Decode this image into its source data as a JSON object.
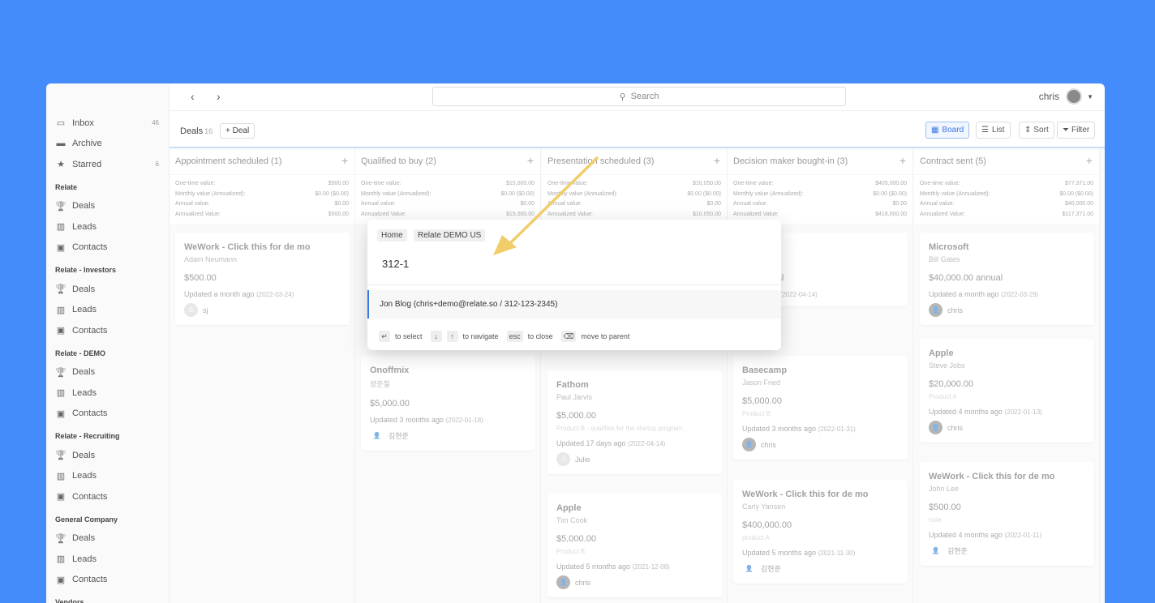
{
  "sidebar": {
    "top": [
      {
        "label": "Inbox",
        "count": "46",
        "icon": "inbox-icon"
      },
      {
        "label": "Archive",
        "count": "",
        "icon": "archive-icon"
      },
      {
        "label": "Starred",
        "count": "6",
        "icon": "star-icon"
      }
    ],
    "groups": [
      {
        "title": "Relate",
        "items": [
          "Deals",
          "Leads",
          "Contacts"
        ]
      },
      {
        "title": "Relate - Investors",
        "items": [
          "Deals",
          "Leads",
          "Contacts"
        ]
      },
      {
        "title": "Relate - DEMO",
        "items": [
          "Deals",
          "Leads",
          "Contacts"
        ]
      },
      {
        "title": "Relate - Recruiting",
        "items": [
          "Deals",
          "Leads",
          "Contacts"
        ]
      },
      {
        "title": "General Company",
        "items": [
          "Deals",
          "Leads",
          "Contacts"
        ]
      },
      {
        "title": "Vendors",
        "items": []
      }
    ]
  },
  "header": {
    "search_placeholder": "Search",
    "user": "chris"
  },
  "toolbar": {
    "title": "Deals",
    "count": "16",
    "add_deal": "+ Deal",
    "board": "Board",
    "list": "List",
    "sort": "Sort",
    "filter": "Filter"
  },
  "stat_labels": [
    "One-time value:",
    "Monthly value (Annualized):",
    "Annual value:",
    "Annualized Value:"
  ],
  "columns": [
    {
      "title": "Appointment scheduled (1)",
      "stats": [
        "$500.00",
        "$0.00 ($0.00)",
        "$0.00",
        "$500.00"
      ],
      "cards": [
        {
          "title": "WeWork - Click this for de mo",
          "person": "Adam Neumann",
          "value": "$500.00",
          "product": "",
          "updated": "Updated a month ago",
          "date": "(2022-03-24)",
          "owner": "sj",
          "owner_initial": "S"
        }
      ]
    },
    {
      "title": "Qualified to buy (2)",
      "stats": [
        "$15,000.00",
        "$0.00 ($0.00)",
        "$0.00",
        "$15,000.00"
      ],
      "cards": [
        {
          "title": "Onoffmix",
          "person": "양준철",
          "value": "$5,000.00",
          "product": "",
          "updated": "Updated 3 months ago",
          "date": "(2022-01-18)",
          "owner": "김현준",
          "owner_initial": ""
        }
      ]
    },
    {
      "title": "Presentation scheduled (3)",
      "stats": [
        "$10,050.00",
        "$0.00 ($0.00)",
        "$0.00",
        "$10,050.00"
      ],
      "cards": [
        {
          "title": "Fathom",
          "person": "Paul Jarvis",
          "value": "$5,000.00",
          "product": "Product B - qualifies for the startup program.",
          "updated": "Updated 17 days ago",
          "date": "(2022-04-14)",
          "owner": "Julie",
          "owner_initial": "J"
        },
        {
          "title": "Apple",
          "person": "Tim Cook",
          "value": "$5,000.00",
          "product": "Product B",
          "updated": "Updated 5 months ago",
          "date": "(2021-12-08)",
          "owner": "chris",
          "owner_initial": ""
        }
      ]
    },
    {
      "title": "Decision maker bought-in (3)",
      "stats": [
        "$405,000.00",
        "$0.00 ($0.00)",
        "$0.00",
        "$418,000.00"
      ],
      "cards": [
        {
          "title": "o",
          "person": "nson",
          "value": ".00 annual",
          "product": "",
          "updated": "7 days ago",
          "date": "(2022-04-14)",
          "owner": "",
          "owner_initial": ""
        },
        {
          "title": "Basecamp",
          "person": "Jason Fried",
          "value": "$5,000.00",
          "product": "Product B",
          "updated": "Updated 3 months ago",
          "date": "(2022-01-31)",
          "owner": "chris",
          "owner_initial": ""
        },
        {
          "title": "WeWork - Click this for de mo",
          "person": "Carly Yansen",
          "value": "$400,000.00",
          "product": "product A",
          "updated": "Updated 5 months ago",
          "date": "(2021-11-30)",
          "owner": "김현준",
          "owner_initial": ""
        }
      ]
    },
    {
      "title": "Contract sent (5)",
      "stats": [
        "$77,371.00",
        "$0.00 ($0.00)",
        "$40,000.00",
        "$117,371.00"
      ],
      "cards": [
        {
          "title": "Microsoft",
          "person": "Bill Gates",
          "value": "$40,000.00 annual",
          "product": "",
          "updated": "Updated a month ago",
          "date": "(2022-03-29)",
          "owner": "chris",
          "owner_initial": ""
        },
        {
          "title": "Apple",
          "person": "Steve Jobs",
          "value": "$20,000.00",
          "product": "Product A",
          "updated": "Updated 4 months ago",
          "date": "(2022-01-13)",
          "owner": "chris",
          "owner_initial": ""
        },
        {
          "title": "WeWork - Click this for de mo",
          "person": "John Lee",
          "value": "$500.00",
          "product": "note",
          "updated": "Updated 4 months ago",
          "date": "(2022-01-11)",
          "owner": "김현준",
          "owner_initial": ""
        }
      ]
    }
  ],
  "palette": {
    "crumbs": [
      "Home",
      "Relate DEMO US"
    ],
    "query": "312-1",
    "result": "Jon Blog (chris+demo@relate.so / 312-123-2345)",
    "hints": [
      {
        "key": "↵",
        "label": "to select"
      },
      {
        "key": "↓",
        "label": ""
      },
      {
        "key": "↑",
        "label": "to navigate"
      },
      {
        "key": "esc",
        "label": "to close"
      },
      {
        "key": "⌫",
        "label": "move to parent"
      }
    ]
  },
  "colors": {
    "background": "#448cfb",
    "accent": "#3b78e7",
    "arrow": "#f0cd6a"
  }
}
